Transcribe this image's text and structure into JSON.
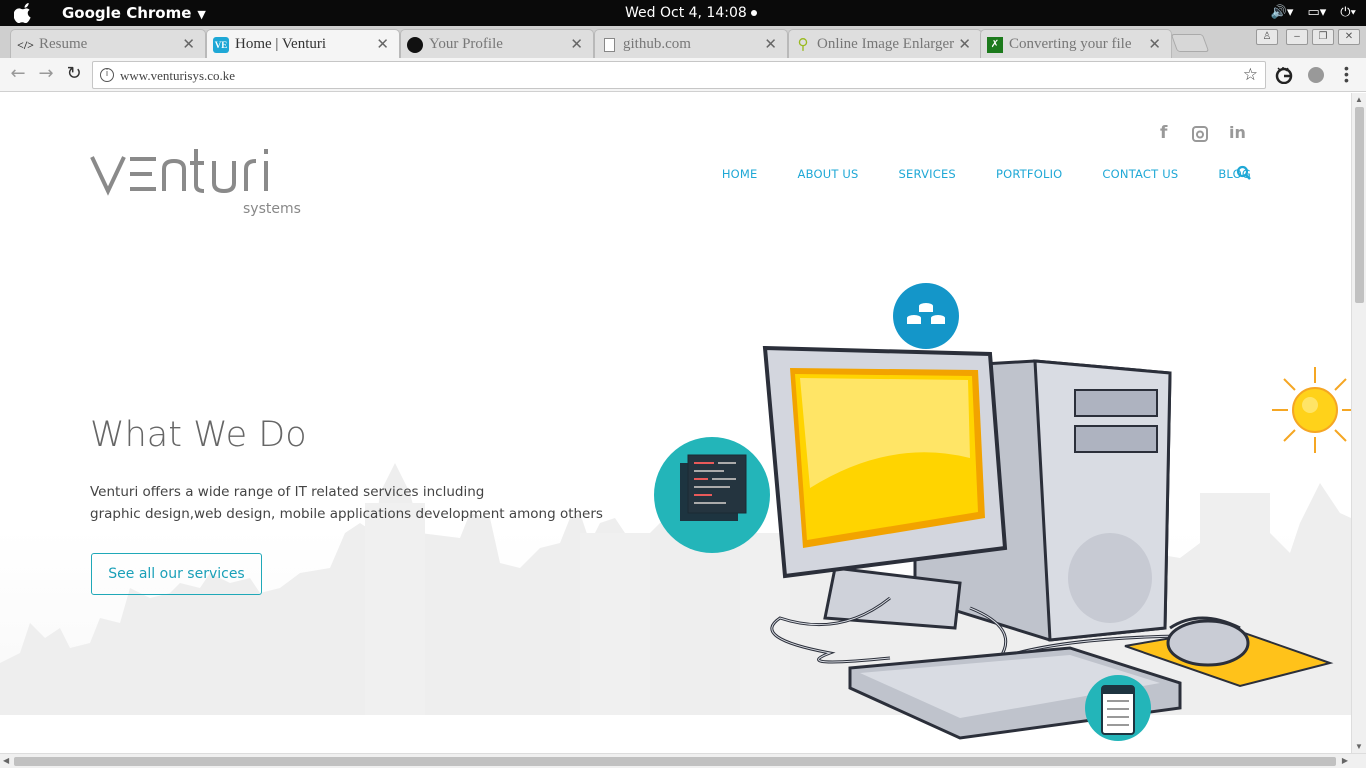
{
  "os_bar": {
    "app_name": "Google Chrome",
    "clock": "Wed Oct  4, 14:08"
  },
  "tabs": [
    {
      "label": "Resume",
      "icon": "code-icon",
      "active": false
    },
    {
      "label": "Home | Venturi",
      "icon": "venturi-favicon",
      "active": true
    },
    {
      "label": "Your Profile",
      "icon": "github-icon",
      "active": false
    },
    {
      "label": "github.com",
      "icon": "page-icon",
      "active": false
    },
    {
      "label": "Online Image Enlarger",
      "icon": "magnifier-icon",
      "active": false
    },
    {
      "label": "Converting your file",
      "icon": "converter-icon",
      "active": false
    }
  ],
  "toolbar": {
    "url": "www.venturisys.co.ke"
  },
  "site": {
    "logo_main": "v=nturi",
    "logo_sub": "systems",
    "social": [
      "facebook-icon",
      "instagram-icon",
      "linkedin-icon"
    ],
    "nav": [
      "HOME",
      "ABOUT US",
      "SERVICES",
      "PORTFOLIO",
      "CONTACT US",
      "BLOG"
    ],
    "heading": "What We Do",
    "desc_line1": "Venturi offers a wide range of IT related services including",
    "desc_line2": "graphic design,web design, mobile applications development among others",
    "cta": "See all our services"
  },
  "colors": {
    "accent": "#1fa8d6",
    "teal": "#23b5b9",
    "os_bar": "#0a0a0a",
    "screen_yellow": "#ffd400"
  }
}
